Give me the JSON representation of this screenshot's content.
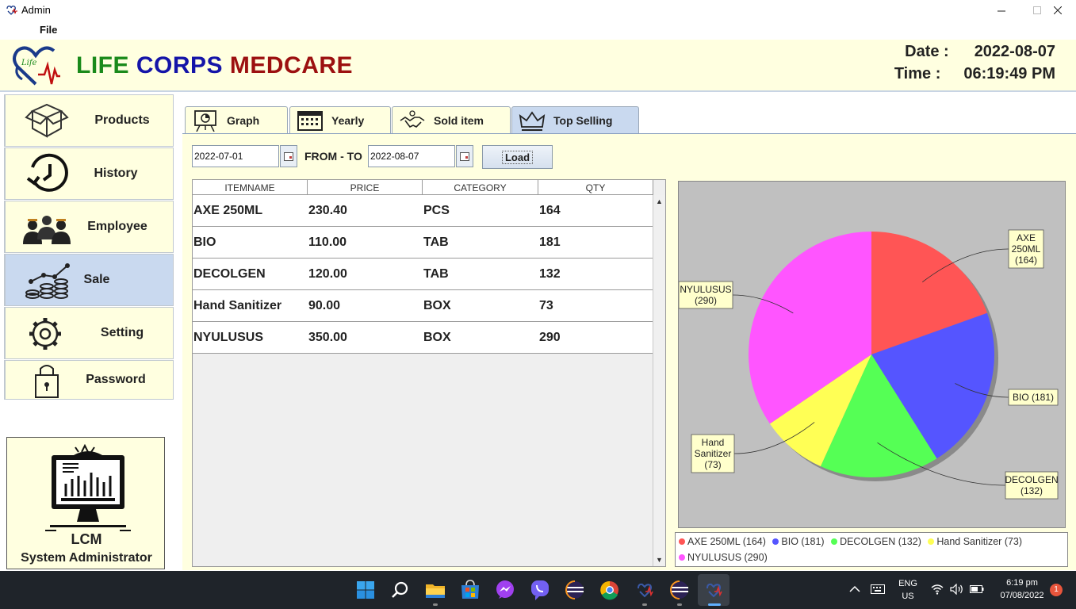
{
  "window": {
    "title": "Admin",
    "minimize_icon": "minimize-icon",
    "maximize_icon": "maximize-icon",
    "close_icon": "close-icon"
  },
  "menu": {
    "file": "File"
  },
  "header": {
    "brand_word1": "LIFE",
    "brand_word2": "CORPS",
    "brand_word3": "MEDCARE",
    "date_label": "Date :",
    "date_value": "2022-08-07",
    "time_label": "Time :",
    "time_value": "06:19:49 PM",
    "colors": {
      "life": "#1a8a1a",
      "corps": "#1414a8",
      "medcare": "#9c1010",
      "header_bg": "#ffffe0"
    }
  },
  "sidebar": {
    "items": [
      {
        "label": "Products",
        "icon": "box-icon"
      },
      {
        "label": "History",
        "icon": "history-clock-icon"
      },
      {
        "label": "Employee",
        "icon": "employees-icon"
      },
      {
        "label": "Sale",
        "icon": "sales-chart-icon",
        "active": true
      },
      {
        "label": "Setting",
        "icon": "gear-icon"
      },
      {
        "label": "Password",
        "icon": "lock-icon"
      }
    ],
    "profile": {
      "short": "LCM",
      "role": "System Administrator",
      "icon": "monitor-chart-icon"
    }
  },
  "tabs": [
    {
      "label": "Graph",
      "icon": "presentation-icon"
    },
    {
      "label": "Yearly",
      "icon": "calendar-icon"
    },
    {
      "label": "Sold item",
      "icon": "handshake-icon"
    },
    {
      "label": "Top Selling",
      "icon": "crown-icon",
      "active": true
    }
  ],
  "filter": {
    "from_date": "2022-07-01",
    "to_date": "2022-08-07",
    "from_to_label": "FROM - TO",
    "load_label": "Load"
  },
  "table": {
    "columns": [
      "ITEMNAME",
      "PRICE",
      "CATEGORY",
      "QTY"
    ],
    "rows": [
      [
        "AXE 250ML",
        "230.40",
        "PCS",
        "164"
      ],
      [
        "BIO",
        "110.00",
        "TAB",
        "181"
      ],
      [
        "DECOLGEN",
        "120.00",
        "TAB",
        "132"
      ],
      [
        "Hand Sanitizer",
        "90.00",
        "BOX",
        "73"
      ],
      [
        "NYULUSUS",
        "350.00",
        "BOX",
        "290"
      ]
    ]
  },
  "chart_data": {
    "type": "pie",
    "categories": [
      "AXE 250ML",
      "BIO",
      "DECOLGEN",
      "Hand Sanitizer",
      "NYULUSUS"
    ],
    "values": [
      164,
      181,
      132,
      73,
      290
    ],
    "colors": [
      "#ff5555",
      "#5555ff",
      "#55ff55",
      "#ffff55",
      "#ff55ff"
    ],
    "labels": [
      "AXE 250ML (164)",
      "BIO (181)",
      "DECOLGEN (132)",
      "Hand Sanitizer (73)",
      "NYULUSUS (290)"
    ],
    "callouts": [
      [
        "AXE",
        "250ML",
        "(164)"
      ],
      [
        "BIO (181)"
      ],
      [
        "DECOLGEN",
        "(132)"
      ],
      [
        "Hand",
        "Sanitizer",
        "(73)"
      ],
      [
        "NYULUSUS",
        "(290)"
      ]
    ],
    "legend": "bottom",
    "background": "#c0c0c0"
  },
  "taskbar": {
    "apps": [
      "windows-start-icon",
      "search-icon",
      "file-explorer-icon",
      "microsoft-store-icon",
      "messenger-icon",
      "viber-icon",
      "eclipse-icon",
      "chrome-icon",
      "java-app-icon",
      "eclipse-icon",
      "java-app-icon"
    ],
    "lang": "ENG",
    "region": "US",
    "time": "6:19 pm",
    "date": "07/08/2022",
    "notification_count": "1"
  }
}
